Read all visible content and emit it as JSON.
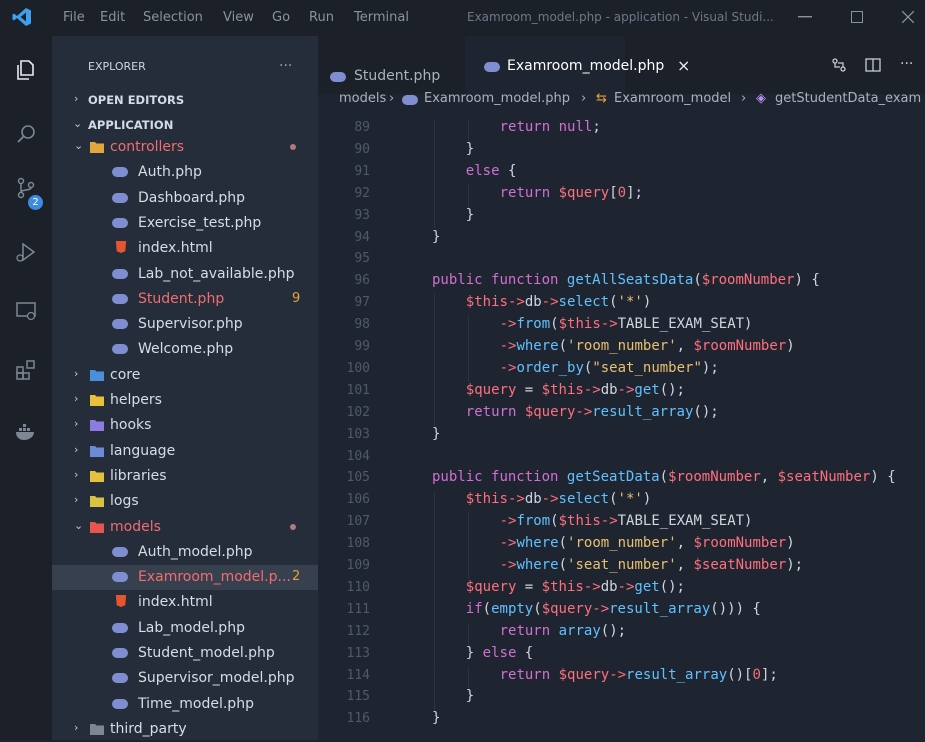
{
  "window": {
    "title": "Examroom_model.php - application - Visual Studi...",
    "menu": [
      "File",
      "Edit",
      "Selection",
      "View",
      "Go",
      "Run",
      "Terminal"
    ]
  },
  "activity_badge": "2",
  "explorer": {
    "title": "EXPLORER",
    "more": "...",
    "open_editors": "OPEN EDITORS",
    "root": "APPLICATION"
  },
  "tree": [
    {
      "label": "controllers",
      "kind": "folder",
      "open": true,
      "depth": 0,
      "err": true,
      "dot": true
    },
    {
      "label": "Auth.php",
      "kind": "php",
      "depth": 1
    },
    {
      "label": "Dashboard.php",
      "kind": "php",
      "depth": 1
    },
    {
      "label": "Exercise_test.php",
      "kind": "php",
      "depth": 1
    },
    {
      "label": "index.html",
      "kind": "html",
      "depth": 1
    },
    {
      "label": "Lab_not_available.php",
      "kind": "php",
      "depth": 1
    },
    {
      "label": "Student.php",
      "kind": "php",
      "depth": 1,
      "err": true,
      "badge": "9"
    },
    {
      "label": "Supervisor.php",
      "kind": "php",
      "depth": 1
    },
    {
      "label": "Welcome.php",
      "kind": "php",
      "depth": 1
    },
    {
      "label": "core",
      "kind": "folder",
      "open": false,
      "depth": 0
    },
    {
      "label": "helpers",
      "kind": "folder",
      "open": false,
      "depth": 0
    },
    {
      "label": "hooks",
      "kind": "folder",
      "open": false,
      "depth": 0
    },
    {
      "label": "language",
      "kind": "folder",
      "open": false,
      "depth": 0
    },
    {
      "label": "libraries",
      "kind": "folder",
      "open": false,
      "depth": 0
    },
    {
      "label": "logs",
      "kind": "folder",
      "open": false,
      "depth": 0
    },
    {
      "label": "models",
      "kind": "folder",
      "open": true,
      "depth": 0,
      "err": true,
      "dot": true
    },
    {
      "label": "Auth_model.php",
      "kind": "php",
      "depth": 1
    },
    {
      "label": "Examroom_model.p...",
      "kind": "php",
      "depth": 1,
      "err": true,
      "badge": "2",
      "selected": true
    },
    {
      "label": "index.html",
      "kind": "html",
      "depth": 1
    },
    {
      "label": "Lab_model.php",
      "kind": "php",
      "depth": 1
    },
    {
      "label": "Student_model.php",
      "kind": "php",
      "depth": 1
    },
    {
      "label": "Supervisor_model.php",
      "kind": "php",
      "depth": 1
    },
    {
      "label": "Time_model.php",
      "kind": "php",
      "depth": 1
    },
    {
      "label": "third_party",
      "kind": "folder",
      "open": false,
      "depth": 0
    }
  ],
  "tabs": [
    {
      "label": "Student.php",
      "active": false
    },
    {
      "label": "Examroom_model.php",
      "active": true,
      "close": "×"
    }
  ],
  "tab_actions": [
    "compare-icon",
    "split-editor-icon",
    "more-icon"
  ],
  "breadcrumb": [
    "models",
    "Examroom_model.php",
    "Examroom_model",
    "getStudentData_exam"
  ],
  "code": {
    "lines": [
      {
        "n": "89",
        "indent": 3,
        "text": "return null;"
      },
      {
        "n": "90",
        "indent": 2,
        "text": "}"
      },
      {
        "n": "91",
        "indent": 2,
        "text": "else {"
      },
      {
        "n": "92",
        "indent": 3,
        "text": "return $query[0];"
      },
      {
        "n": "93",
        "indent": 2,
        "text": "}"
      },
      {
        "n": "94",
        "indent": 1,
        "text": "}"
      },
      {
        "n": "95",
        "indent": 0,
        "text": ""
      },
      {
        "n": "96",
        "indent": 1,
        "text": "public function getAllSeatsData($roomNumber) {"
      },
      {
        "n": "97",
        "indent": 2,
        "text": "$this->db->select('*')"
      },
      {
        "n": "98",
        "indent": 3,
        "text": "->from($this->TABLE_EXAM_SEAT)"
      },
      {
        "n": "99",
        "indent": 3,
        "text": "->where('room_number', $roomNumber)"
      },
      {
        "n": "100",
        "indent": 3,
        "text": "->order_by(\"seat_number\");"
      },
      {
        "n": "101",
        "indent": 2,
        "text": "$query = $this->db->get();"
      },
      {
        "n": "102",
        "indent": 2,
        "text": "return $query->result_array();"
      },
      {
        "n": "103",
        "indent": 1,
        "text": "}"
      },
      {
        "n": "104",
        "indent": 0,
        "text": ""
      },
      {
        "n": "105",
        "indent": 1,
        "text": "public function getSeatData($roomNumber, $seatNumber) {"
      },
      {
        "n": "106",
        "indent": 2,
        "text": "$this->db->select('*')"
      },
      {
        "n": "107",
        "indent": 3,
        "text": "->from($this->TABLE_EXAM_SEAT)"
      },
      {
        "n": "108",
        "indent": 3,
        "text": "->where('room_number', $roomNumber)"
      },
      {
        "n": "109",
        "indent": 3,
        "text": "->where('seat_number', $seatNumber);"
      },
      {
        "n": "110",
        "indent": 2,
        "text": "$query = $this->db->get();"
      },
      {
        "n": "111",
        "indent": 2,
        "text": "if(empty($query->result_array())) {"
      },
      {
        "n": "112",
        "indent": 3,
        "text": "return array();"
      },
      {
        "n": "113",
        "indent": 2,
        "text": "} else {"
      },
      {
        "n": "114",
        "indent": 3,
        "text": "return $query->result_array()[0];"
      },
      {
        "n": "115",
        "indent": 2,
        "text": "}"
      },
      {
        "n": "116",
        "indent": 1,
        "text": "}"
      }
    ]
  },
  "colors": {
    "keyword": "#d16fd3",
    "function": "#61c0ff",
    "variable": "#ff6f7d",
    "string": "#e8c070",
    "error": "#f26d6d",
    "warning": "#e8a13d"
  }
}
